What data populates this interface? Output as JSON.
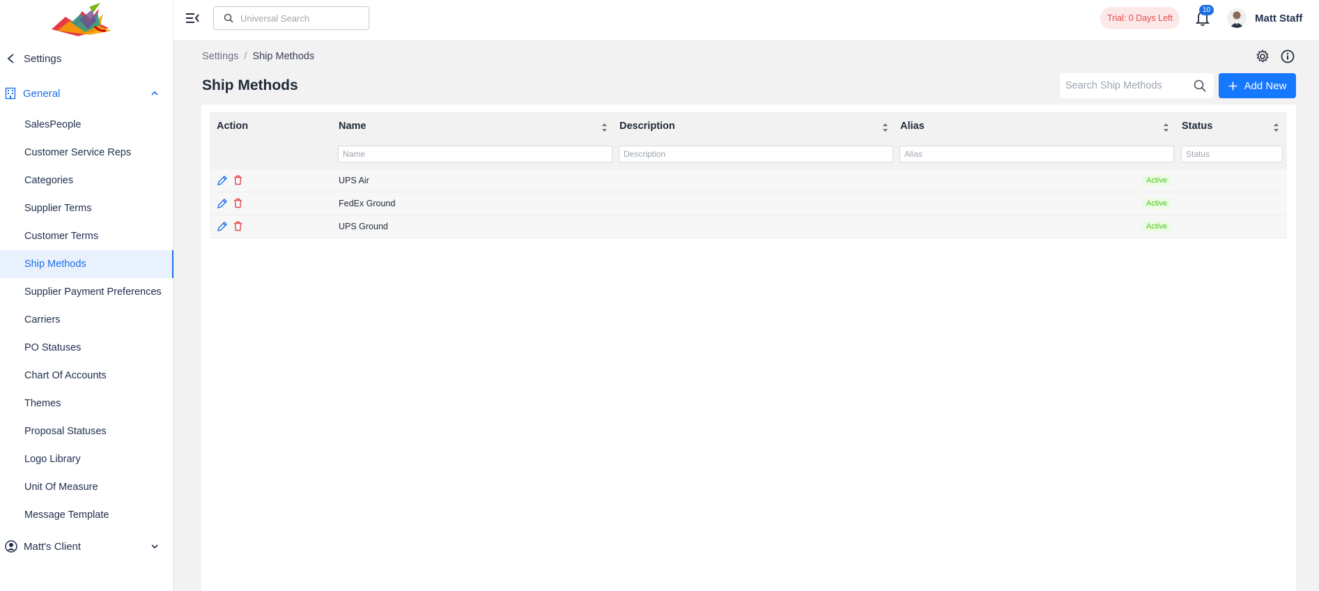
{
  "brand": {
    "primary": "#1677ff",
    "danger": "#e5484d",
    "success": "#52c41a"
  },
  "sidebar": {
    "back_label": "Settings",
    "group_label": "General",
    "items": [
      "SalesPeople",
      "Customer Service Reps",
      "Categories",
      "Supplier Terms",
      "Customer Terms",
      "Ship Methods",
      "Supplier Payment Preferences",
      "Carriers",
      "PO Statuses",
      "Chart Of Accounts",
      "Themes",
      "Proposal Statuses",
      "Logo Library",
      "Unit Of Measure",
      "Message Template"
    ],
    "active_item": "Ship Methods",
    "client_label": "Matt's Client"
  },
  "topbar": {
    "search_placeholder": "Universal Search",
    "trial_text": "Trial: 0 Days Left",
    "notification_count": "10",
    "user_name": "Matt Staff"
  },
  "breadcrumb": {
    "parent": "Settings",
    "separator": "/",
    "current": "Ship Methods"
  },
  "page": {
    "title": "Ship Methods",
    "search_placeholder": "Search Ship Methods",
    "add_label": "Add New"
  },
  "table": {
    "columns": {
      "action": "Action",
      "name": "Name",
      "description": "Description",
      "alias": "Alias",
      "status": "Status"
    },
    "filters": {
      "name": "Name",
      "description": "Description",
      "alias": "Alias",
      "status": "Status"
    },
    "rows": [
      {
        "name": "UPS Air",
        "description": "",
        "alias": "",
        "status": "Active"
      },
      {
        "name": "FedEx Ground",
        "description": "",
        "alias": "",
        "status": "Active"
      },
      {
        "name": "UPS Ground",
        "description": "",
        "alias": "",
        "status": "Active"
      }
    ]
  }
}
